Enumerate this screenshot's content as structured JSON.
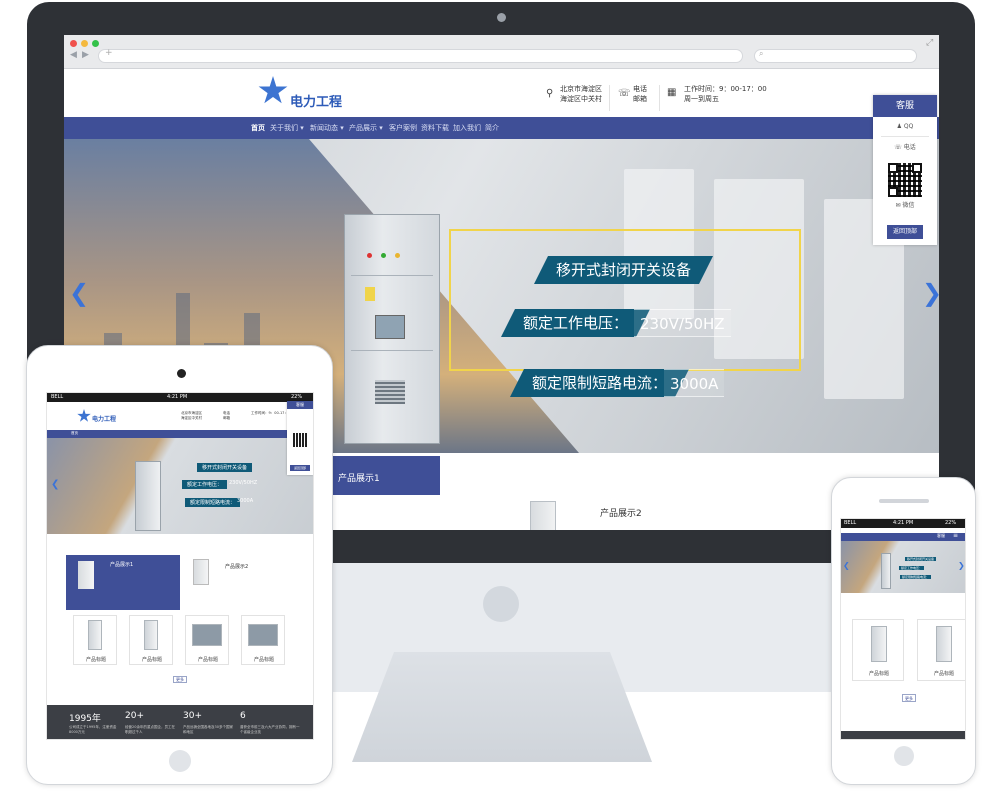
{
  "site": {
    "logo_text": "电力工程",
    "address_line1": "北京市海淀区",
    "address_line2": "海淀区中关村",
    "contact_line1": "电话",
    "contact_line2": "邮箱",
    "hours_line1": "工作时间：9：00-17：00",
    "hours_line2": "周一到周五"
  },
  "nav": {
    "items": [
      {
        "label": "首页"
      },
      {
        "label": "关于我们"
      },
      {
        "label": "新闻动态"
      },
      {
        "label": "产品展示"
      },
      {
        "label": "客户案例"
      },
      {
        "label": "资料下载"
      },
      {
        "label": "加入我们"
      },
      {
        "label": "简介"
      }
    ]
  },
  "banner": {
    "headline": "移开式封闭开关设备",
    "spec1_label": "额定工作电压：",
    "spec1_value": "230V/50HZ",
    "spec2_label": "额定限制短路电流：",
    "spec2_value": "3000A"
  },
  "products": {
    "tab1": "产品展示1",
    "tab2": "产品展示2",
    "item_caption": "产品标题",
    "more_label": "更多"
  },
  "service": {
    "title": "客服",
    "qq": "QQ",
    "phone": "电话",
    "wechat": "微信",
    "back_top": "返回顶部"
  },
  "stats": {
    "s1_value": "1995年",
    "s1_text": "公司成立于1995年，注册资金8000万元",
    "s2_value": "20+",
    "s2_text": "经营20余年的重点国企，员工在职超过千人",
    "s3_value": "30+",
    "s3_text": "产品远销全国各地及30多个国家和地区",
    "s4_value": "6",
    "s4_text": "曾获全市前三及六大产业协同，拥有一个省级企业技"
  },
  "status_bar": {
    "carrier": "BELL",
    "time": "4:21 PM",
    "battery": "22%"
  },
  "colors": {
    "brand": "#3f4f97",
    "logo": "#3d74d1",
    "ribbon": "#0f5a78",
    "accent_frame": "#f1d44a"
  },
  "icons": {
    "address": "map-pin-icon",
    "contact": "phone-icon",
    "hours": "calendar-icon",
    "qq": "qq-icon",
    "wechat": "wechat-icon"
  }
}
